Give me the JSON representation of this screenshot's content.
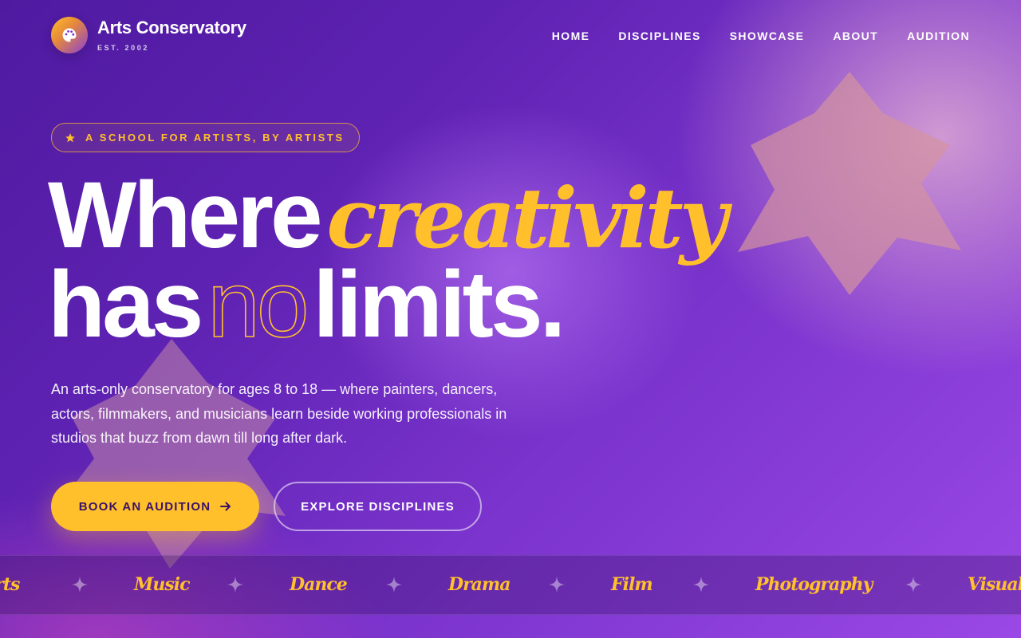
{
  "brand": {
    "name": "Arts Conservatory",
    "sub": "EST. 2002",
    "logo_icon": "palette-icon"
  },
  "nav": {
    "items": [
      {
        "label": "HOME"
      },
      {
        "label": "DISCIPLINES"
      },
      {
        "label": "SHOWCASE"
      },
      {
        "label": "ABOUT"
      },
      {
        "label": "AUDITION"
      }
    ]
  },
  "hero": {
    "badge": "A SCHOOL FOR ARTISTS, BY ARTISTS",
    "badge_icon": "star-icon",
    "headline": {
      "line1_a": "Where",
      "line1_b": "creativity",
      "line2_a": "has",
      "line2_b": "no",
      "line2_c": "limits."
    },
    "description": "An arts-only conservatory for ages 8 to 18 — where painters, dancers, actors, filmmakers, and musicians learn beside working professionals in studios that buzz from dawn till long after dark.",
    "cta_primary": "BOOK AN AUDITION",
    "cta_primary_icon": "arrow-right-icon",
    "cta_secondary": "EXPLORE DISCIPLINES"
  },
  "marquee": {
    "separator_icon": "sparkle-icon",
    "items": [
      "arts",
      "Music",
      "Dance",
      "Drama",
      "Film",
      "Photography",
      "Visual A"
    ]
  },
  "colors": {
    "accent": "#ffc02b",
    "primary_text_on_accent": "#3b1268",
    "background_dark": "#4f1aa0",
    "background_light": "#9a48e6",
    "deco_star": "#c98aa8"
  }
}
